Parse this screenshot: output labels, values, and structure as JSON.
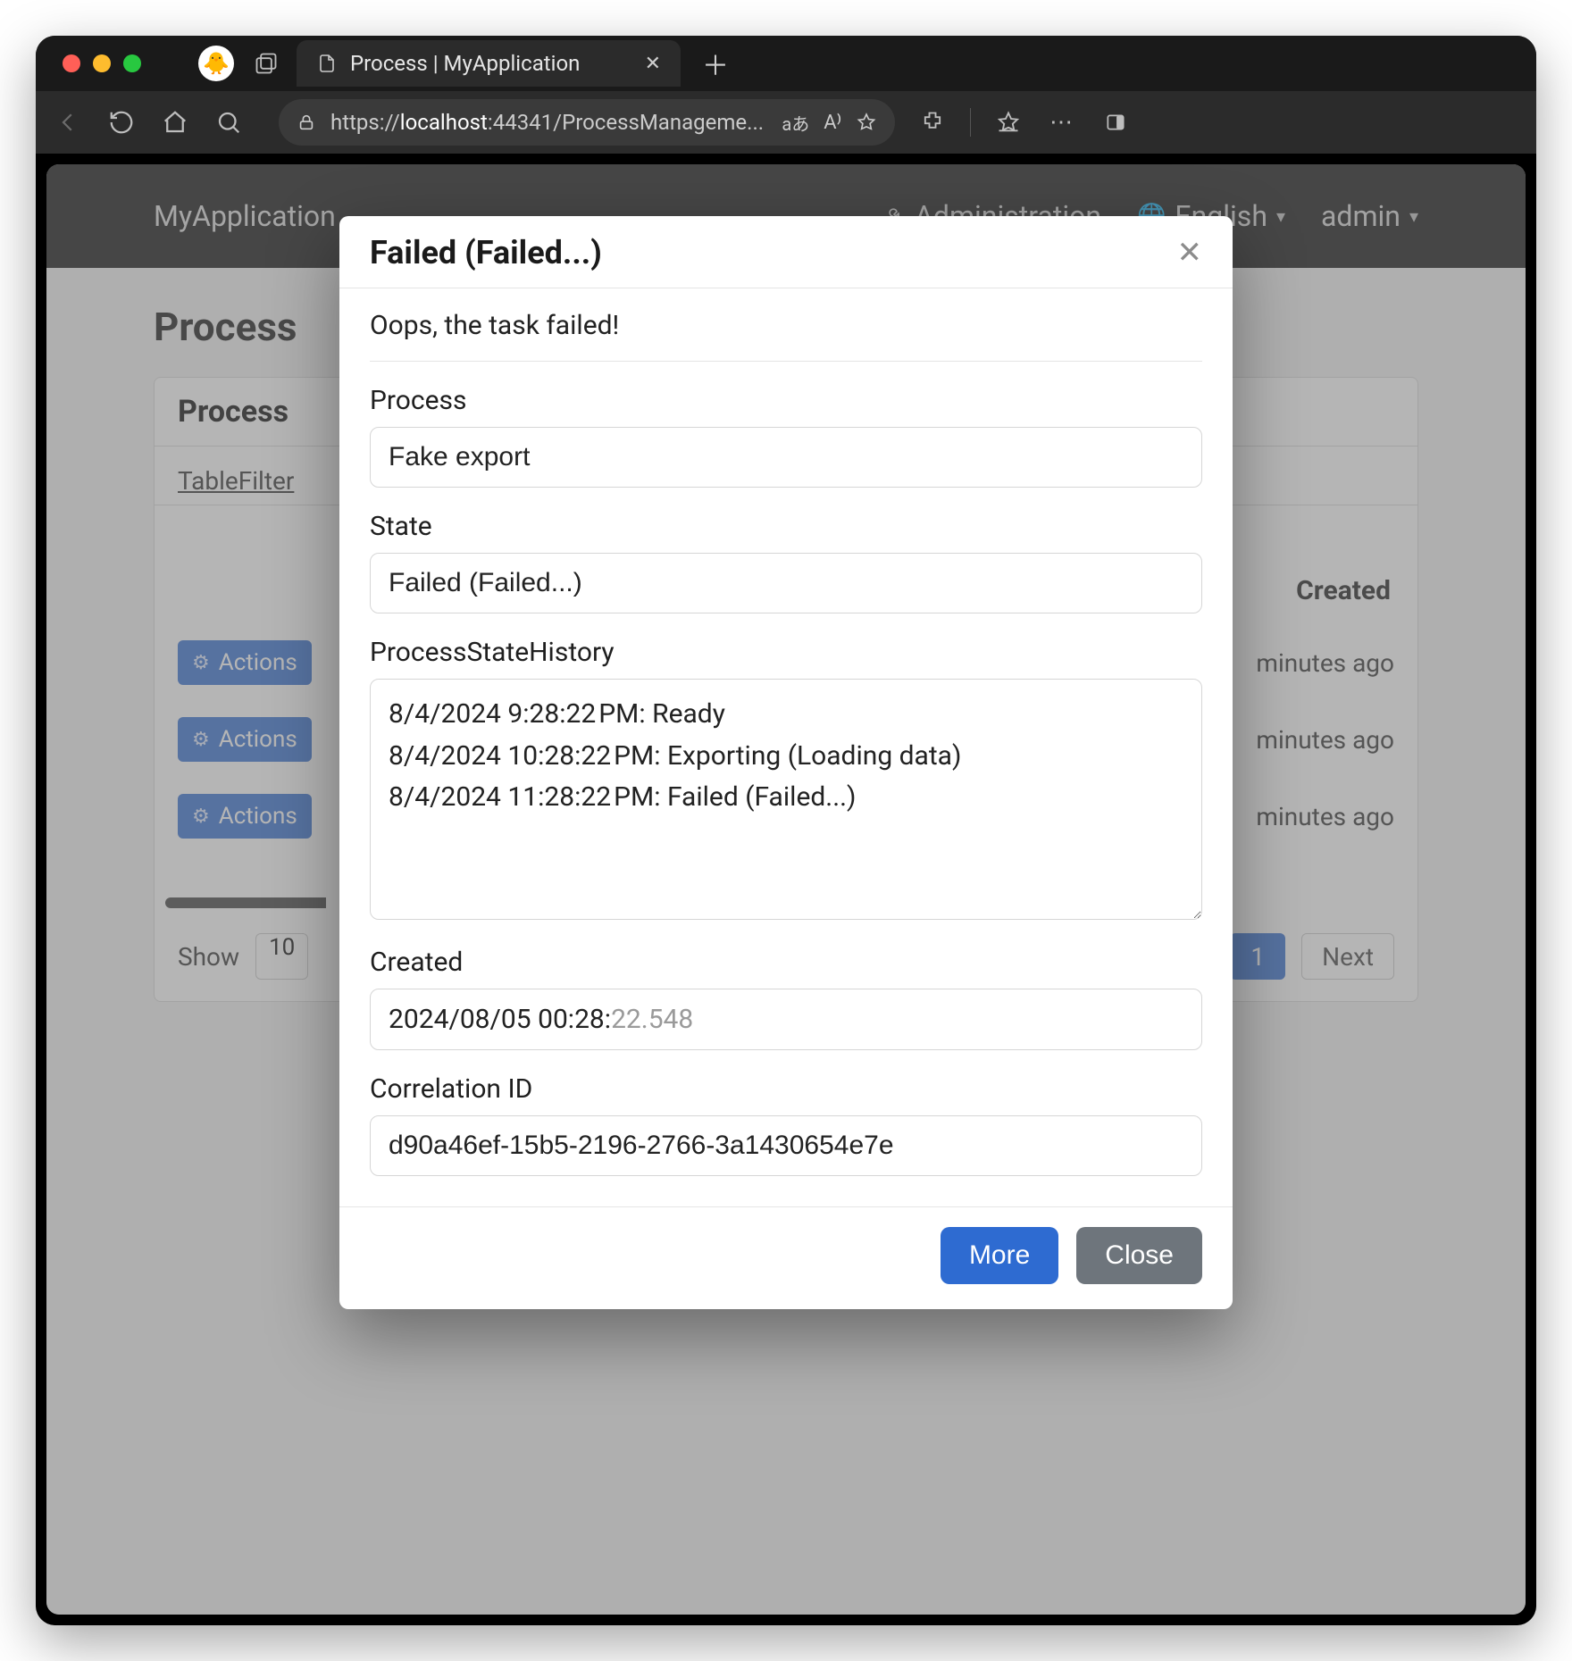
{
  "browser": {
    "tab_title": "Process | MyApplication",
    "url_prefix": "https://",
    "url_host": "localhost",
    "url_port_path": ":44341/ProcessManageme...",
    "lang_badge": "aあ"
  },
  "app_nav": {
    "brand": "MyApplication",
    "admin_label": "Administration",
    "language": "English",
    "user": "admin"
  },
  "page": {
    "title": "Process",
    "panel_title": "Process",
    "table_filter_label": "TableFilter",
    "col_created": "Created",
    "actions_label": "Actions",
    "rows": [
      {
        "created": "minutes ago"
      },
      {
        "created": "minutes ago"
      },
      {
        "created": "minutes ago"
      }
    ],
    "pager": {
      "show_label": "Show",
      "size": "10",
      "current": "1",
      "next": "Next"
    }
  },
  "modal": {
    "title": "Failed (Failed...)",
    "message": "Oops, the task failed!",
    "fields": {
      "process": {
        "label": "Process",
        "value": "Fake export"
      },
      "state": {
        "label": "State",
        "value": "Failed (Failed...)"
      },
      "history": {
        "label": "ProcessStateHistory",
        "value": "8/4/2024 9:28:22 PM: Ready\n8/4/2024 10:28:22 PM: Exporting (Loading data)\n8/4/2024 11:28:22 PM: Failed (Failed...)"
      },
      "created": {
        "label": "Created",
        "value_main": "2024/08/05 00:28:",
        "value_ms": "22.548"
      },
      "corr": {
        "label": "Correlation ID",
        "value": "d90a46ef-15b5-2196-2766-3a1430654e7e"
      }
    },
    "buttons": {
      "more": "More",
      "close": "Close"
    }
  },
  "colors": {
    "primary": "#2e6bd1",
    "secondary": "#6e757c"
  }
}
